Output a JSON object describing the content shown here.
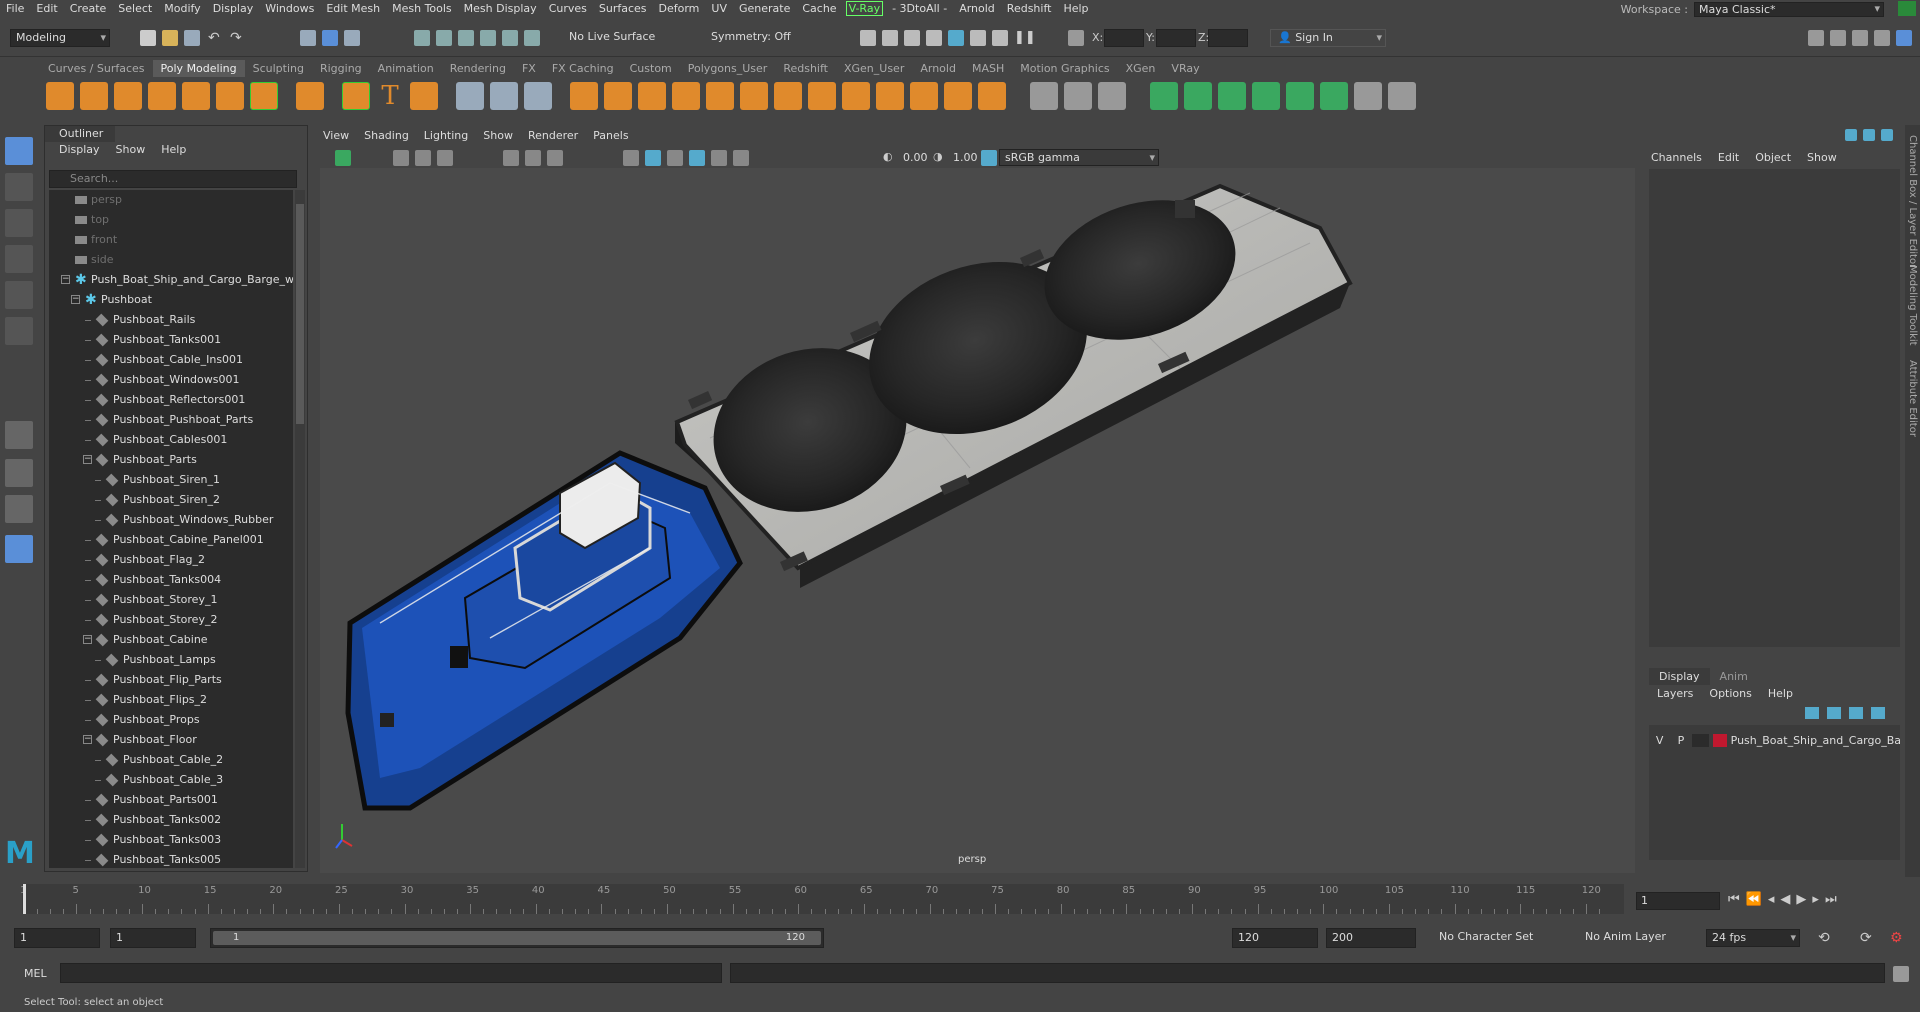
{
  "menubar": {
    "items": [
      "File",
      "Edit",
      "Create",
      "Select",
      "Modify",
      "Display",
      "Windows",
      "Edit Mesh",
      "Mesh Tools",
      "Mesh Display",
      "Curves",
      "Surfaces",
      "Deform",
      "UV",
      "Generate",
      "Cache",
      "V-Ray",
      "- 3DtoAll -",
      "Arnold",
      "Redshift",
      "Help"
    ],
    "workspace_label": "Workspace :",
    "workspace_value": "Maya Classic*"
  },
  "statusline": {
    "mode": "Modeling",
    "live_surface": "No Live Surface",
    "symmetry": "Symmetry: Off",
    "x_label": "X:",
    "y_label": "Y:",
    "z_label": "Z:",
    "sign_in": "Sign In"
  },
  "shelf": {
    "tabs": [
      "Curves / Surfaces",
      "Poly Modeling",
      "Sculpting",
      "Rigging",
      "Animation",
      "Rendering",
      "FX",
      "FX Caching",
      "Custom",
      "Polygons_User",
      "Redshift",
      "XGen_User",
      "Arnold",
      "MASH",
      "Motion Graphics",
      "XGen",
      "VRay"
    ],
    "active_tab": "Poly Modeling"
  },
  "outliner": {
    "title": "Outliner",
    "menu": [
      "Display",
      "Show",
      "Help"
    ],
    "search_placeholder": "Search...",
    "items": [
      {
        "label": "persp",
        "indent": 0,
        "type": "camera",
        "dim": true
      },
      {
        "label": "top",
        "indent": 0,
        "type": "camera",
        "dim": true
      },
      {
        "label": "front",
        "indent": 0,
        "type": "camera",
        "dim": true
      },
      {
        "label": "side",
        "indent": 0,
        "type": "camera",
        "dim": true
      },
      {
        "label": "Push_Boat_Ship_and_Cargo_Barge_w",
        "indent": 0,
        "type": "group",
        "expanded": true
      },
      {
        "label": "Pushboat",
        "indent": 1,
        "type": "group",
        "expanded": true
      },
      {
        "label": "Pushboat_Rails",
        "indent": 2,
        "type": "mesh"
      },
      {
        "label": "Pushboat_Tanks001",
        "indent": 2,
        "type": "mesh"
      },
      {
        "label": "Pushboat_Cable_Ins001",
        "indent": 2,
        "type": "mesh"
      },
      {
        "label": "Pushboat_Windows001",
        "indent": 2,
        "type": "mesh"
      },
      {
        "label": "Pushboat_Reflectors001",
        "indent": 2,
        "type": "mesh"
      },
      {
        "label": "Pushboat_Pushboat_Parts",
        "indent": 2,
        "type": "mesh"
      },
      {
        "label": "Pushboat_Cables001",
        "indent": 2,
        "type": "mesh"
      },
      {
        "label": "Pushboat_Parts",
        "indent": 2,
        "type": "mesh",
        "expanded": true
      },
      {
        "label": "Pushboat_Siren_1",
        "indent": 3,
        "type": "mesh"
      },
      {
        "label": "Pushboat_Siren_2",
        "indent": 3,
        "type": "mesh"
      },
      {
        "label": "Pushboat_Windows_Rubber",
        "indent": 3,
        "type": "mesh"
      },
      {
        "label": "Pushboat_Cabine_Panel001",
        "indent": 2,
        "type": "mesh"
      },
      {
        "label": "Pushboat_Flag_2",
        "indent": 2,
        "type": "mesh"
      },
      {
        "label": "Pushboat_Tanks004",
        "indent": 2,
        "type": "mesh"
      },
      {
        "label": "Pushboat_Storey_1",
        "indent": 2,
        "type": "mesh"
      },
      {
        "label": "Pushboat_Storey_2",
        "indent": 2,
        "type": "mesh"
      },
      {
        "label": "Pushboat_Cabine",
        "indent": 2,
        "type": "mesh",
        "expanded": true
      },
      {
        "label": "Pushboat_Lamps",
        "indent": 3,
        "type": "mesh"
      },
      {
        "label": "Pushboat_Flip_Parts",
        "indent": 2,
        "type": "mesh"
      },
      {
        "label": "Pushboat_Flips_2",
        "indent": 2,
        "type": "mesh"
      },
      {
        "label": "Pushboat_Props",
        "indent": 2,
        "type": "mesh"
      },
      {
        "label": "Pushboat_Floor",
        "indent": 2,
        "type": "mesh",
        "expanded": true
      },
      {
        "label": "Pushboat_Cable_2",
        "indent": 3,
        "type": "mesh"
      },
      {
        "label": "Pushboat_Cable_3",
        "indent": 3,
        "type": "mesh"
      },
      {
        "label": "Pushboat_Parts001",
        "indent": 2,
        "type": "mesh"
      },
      {
        "label": "Pushboat_Tanks002",
        "indent": 2,
        "type": "mesh"
      },
      {
        "label": "Pushboat_Tanks003",
        "indent": 2,
        "type": "mesh"
      },
      {
        "label": "Pushboat_Tanks005",
        "indent": 2,
        "type": "mesh"
      }
    ]
  },
  "viewport": {
    "menu": [
      "View",
      "Shading",
      "Lighting",
      "Show",
      "Renderer",
      "Panels"
    ],
    "exposure": "0.00",
    "gamma": "1.00",
    "colorspace": "sRGB gamma",
    "camera_label": "persp"
  },
  "channelbox": {
    "menu": [
      "Channels",
      "Edit",
      "Object",
      "Show"
    ],
    "tabs": [
      "Display",
      "Anim"
    ],
    "active_tab": "Display",
    "layer_menu": [
      "Layers",
      "Options",
      "Help"
    ],
    "layer": {
      "v": "V",
      "p": "P",
      "name": "Push_Boat_Ship_and_Cargo_Bar",
      "color": "#c0182f"
    }
  },
  "side_tabs": [
    "Channel Box / Layer Editor",
    "Modeling Toolkit",
    "Attribute Editor"
  ],
  "timeline": {
    "ticks": [
      "1",
      "5",
      "10",
      "15",
      "20",
      "25",
      "30",
      "35",
      "40",
      "45",
      "50",
      "55",
      "60",
      "65",
      "70",
      "75",
      "80",
      "85",
      "90",
      "95",
      "100",
      "105",
      "110",
      "115",
      "120"
    ],
    "current_frame": "1"
  },
  "range": {
    "start": "1",
    "playback_start": "1",
    "slider_start": "1",
    "slider_end": "120",
    "playback_end": "120",
    "end": "200",
    "character_set": "No Character Set",
    "anim_layer": "No Anim Layer",
    "fps": "24 fps"
  },
  "cmdline": {
    "label": "MEL"
  },
  "helpline": {
    "text": "Select Tool: select an object"
  }
}
